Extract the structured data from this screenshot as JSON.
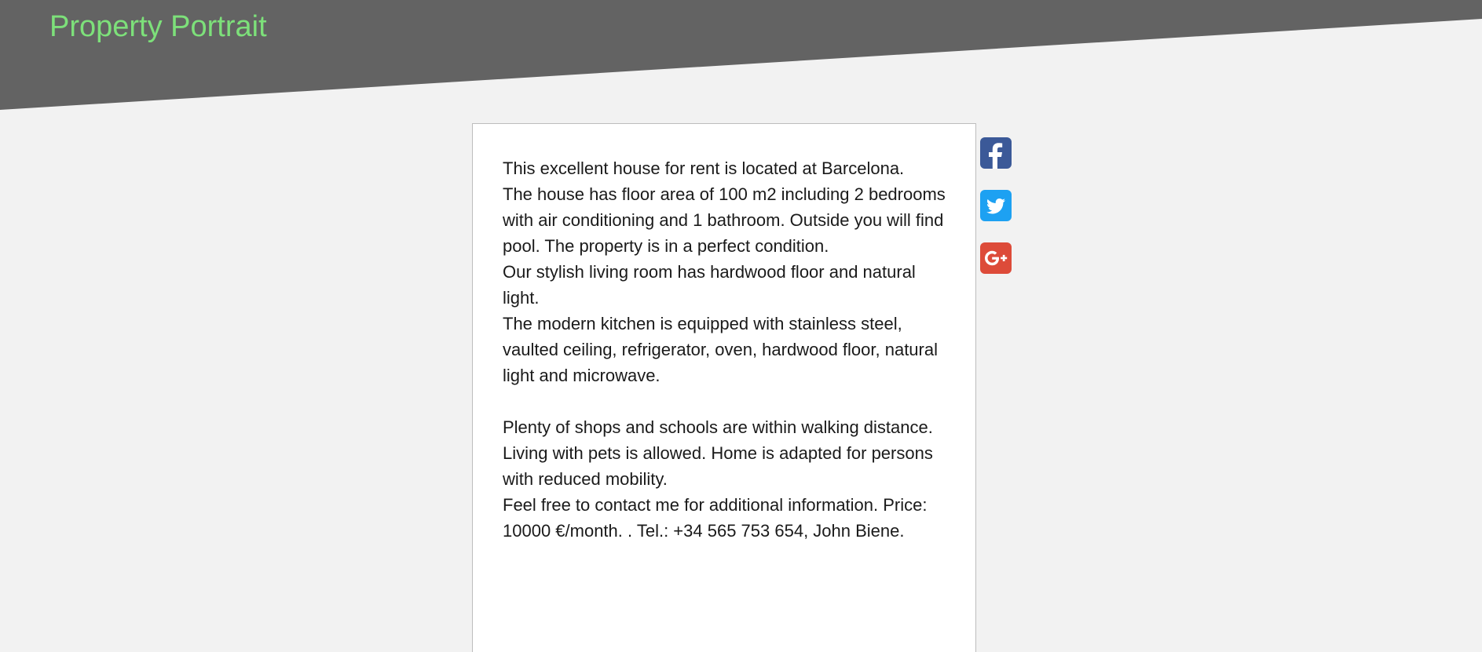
{
  "header": {
    "title": "Property Portrait",
    "colors": {
      "band": "#636363",
      "title": "#7de07a"
    }
  },
  "listing": {
    "paragraphs": [
      "This excellent house for rent is located at Barcelona.",
      "The house has floor area of 100 m2 including 2 bedrooms with air conditioning and 1 bathroom. Outside you will find pool. The property is in a perfect condition.",
      "Our stylish living room has hardwood floor and natural light.",
      "The modern kitchen is equipped with stainless steel, vaulted ceiling, refrigerator, oven, hardwood floor, natural light and microwave.",
      "",
      "Plenty of shops and schools are within walking distance.",
      "Living with pets is allowed. Home is adapted for persons with reduced mobility.",
      "Feel free to contact me for additional information. Price: 10000 €/month. . Tel.: +34 565 753 654, John Biene."
    ]
  },
  "share": [
    {
      "name": "facebook-share-button",
      "icon": "facebook-icon",
      "color": "#3b5998"
    },
    {
      "name": "twitter-share-button",
      "icon": "twitter-icon",
      "color": "#1da1f2"
    },
    {
      "name": "google-plus-share-button",
      "icon": "google-plus-icon",
      "color": "#dd4b39"
    }
  ]
}
